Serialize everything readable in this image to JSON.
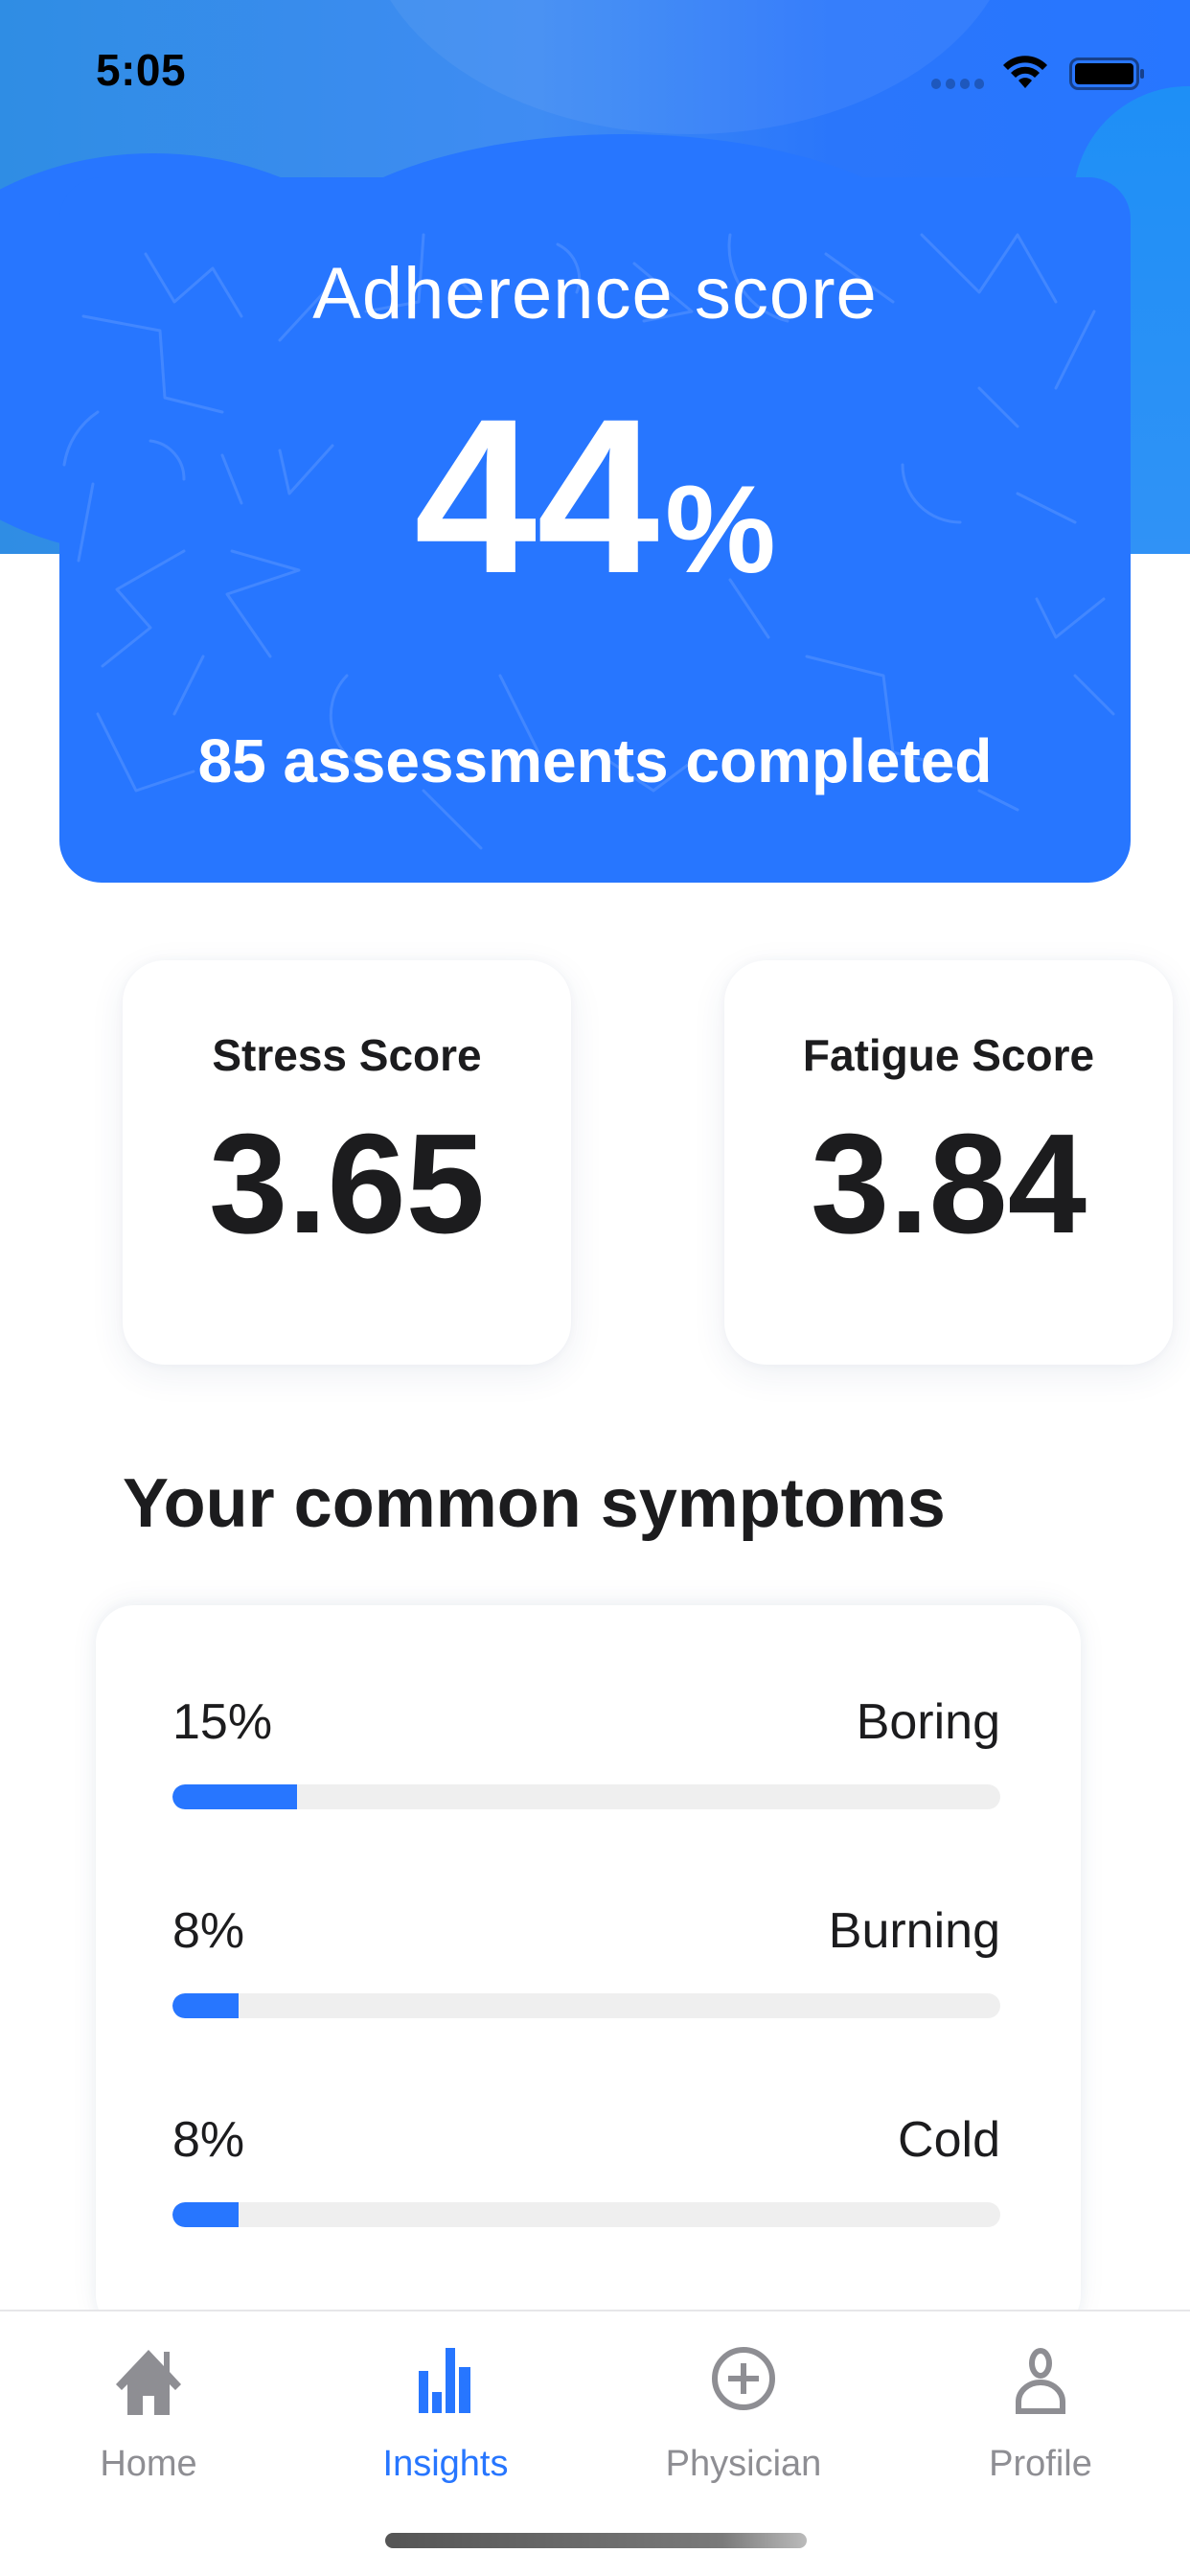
{
  "status_bar": {
    "time": "5:05",
    "icons": [
      "signal-icon",
      "wifi-icon",
      "battery-icon"
    ]
  },
  "adherence": {
    "title": "Adherence score",
    "value": "44",
    "unit": "%",
    "percent": 44,
    "subtitle": "85 assessments completed",
    "accent_color": "#2776ff"
  },
  "scores": [
    {
      "label": "Stress Score",
      "value": "3.65"
    },
    {
      "label": "Fatigue Score",
      "value": "3.84"
    }
  ],
  "symptoms": {
    "title": "Your common symptoms",
    "items": [
      {
        "percent_label": "15%",
        "name": "Boring",
        "percent": 15
      },
      {
        "percent_label": "8%",
        "name": "Burning",
        "percent": 8
      },
      {
        "percent_label": "8%",
        "name": "Cold",
        "percent": 8
      }
    ],
    "bar_color": "#2776ff",
    "track_color": "#efefef"
  },
  "tab_bar": {
    "active": "Insights",
    "tabs": [
      {
        "label": "Home",
        "icon": "home-icon"
      },
      {
        "label": "Insights",
        "icon": "bar-chart-icon"
      },
      {
        "label": "Physician",
        "icon": "plus-circle-icon"
      },
      {
        "label": "Profile",
        "icon": "person-icon"
      }
    ],
    "active_color": "#2776ff",
    "inactive_color": "#8e8e93"
  }
}
